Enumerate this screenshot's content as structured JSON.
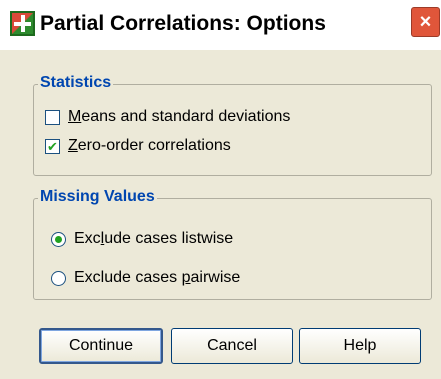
{
  "dialog": {
    "title": "Partial Correlations: Options",
    "close_label": "×"
  },
  "statistics": {
    "legend": "Statistics",
    "items": [
      {
        "prefix": "",
        "mnemonic": "M",
        "rest": "eans and standard deviations",
        "checked": false
      },
      {
        "prefix": "",
        "mnemonic": "Z",
        "rest": "ero-order correlations",
        "checked": true
      }
    ]
  },
  "missing_values": {
    "legend": "Missing Values",
    "options": [
      {
        "prefix": "Exc",
        "mnemonic": "l",
        "rest": "ude cases listwise",
        "selected": true
      },
      {
        "prefix": "Exclude cases ",
        "mnemonic": "p",
        "rest": "airwise",
        "selected": false
      }
    ]
  },
  "buttons": {
    "continue_label": "Continue",
    "cancel_label": "Cancel",
    "help_label": "Help"
  },
  "colors": {
    "accent": "#21a121",
    "legend": "#0046b0",
    "face": "#ece9d8"
  }
}
